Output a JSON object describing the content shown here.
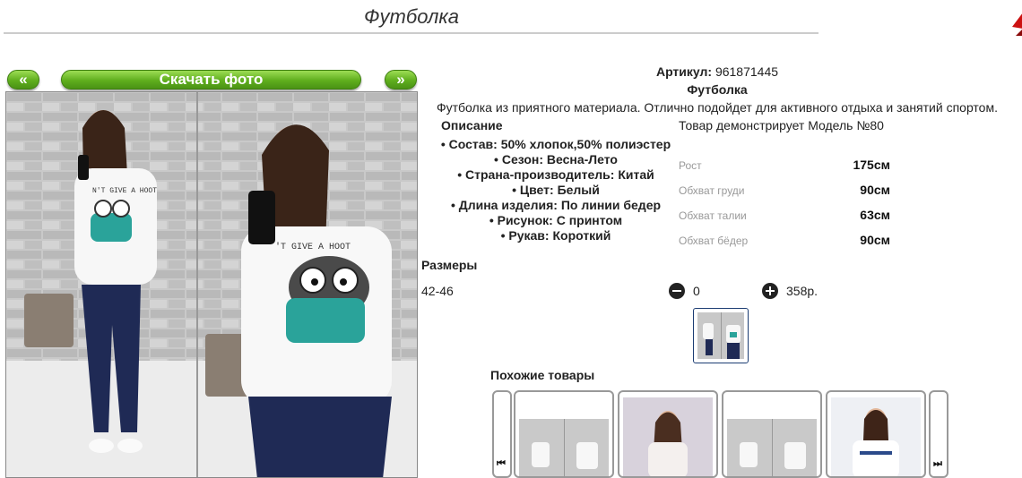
{
  "page": {
    "title": "Футболка"
  },
  "gallery": {
    "prev_label": "«",
    "next_label": "»",
    "download_label": "Скачать фото",
    "photo_print_text": "N'T GIVE A HOOT",
    "photo_print_text2": "'T GIVE A HOOT"
  },
  "product": {
    "article_label": "Артикул:",
    "article_value": "961871445",
    "name": "Футболка",
    "description": "Футболка из приятного материала. Отлично подойдет для активного отдыха и занятий спортом.",
    "description_heading": "Описание",
    "features": [
      "Состав: 50% хлопок,50% полиэстер",
      "Сезон: Весна-Лето",
      "Страна-производитель: Китай",
      "Цвет: Белый",
      "Длина изделия: По линии бедер",
      "Рисунок: С принтом",
      "Рукав: Короткий"
    ]
  },
  "model": {
    "heading": "Товар демонстрирует Модель №80",
    "measurements": [
      {
        "label": "Рост",
        "value": "175см"
      },
      {
        "label": "Обхват груди",
        "value": "90см"
      },
      {
        "label": "Обхват талии",
        "value": "63см"
      },
      {
        "label": "Обхват бёдер",
        "value": "90см"
      }
    ]
  },
  "sizes": {
    "heading": "Размеры",
    "size": "42-46",
    "quantity": "0",
    "price": "358р."
  },
  "similar": {
    "heading": "Похожие товары",
    "left_arrow": "⏮",
    "right_arrow": "⏭"
  },
  "colors": {
    "accent_green": "#5fae1e",
    "thumb_border": "#1c3d73",
    "tshirt_teal": "#2aa39a",
    "jeans": "#1f2a55"
  }
}
